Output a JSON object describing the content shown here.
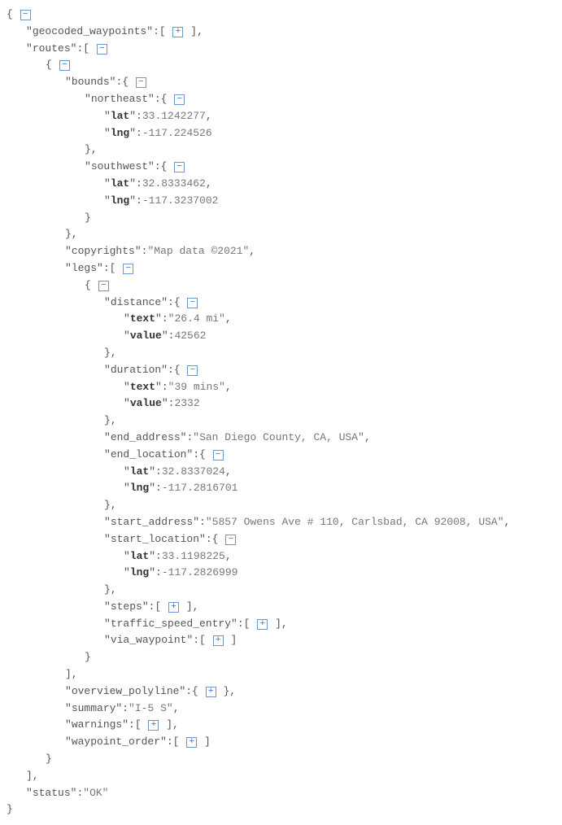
{
  "keys": {
    "geocoded_waypoints": "geocoded_waypoints",
    "routes": "routes",
    "bounds": "bounds",
    "northeast": "northeast",
    "lat": "lat",
    "lng": "lng",
    "southwest": "southwest",
    "copyrights": "copyrights",
    "legs": "legs",
    "distance": "distance",
    "text": "text",
    "value": "value",
    "duration": "duration",
    "end_address": "end_address",
    "end_location": "end_location",
    "start_address": "start_address",
    "start_location": "start_location",
    "steps": "steps",
    "traffic_speed_entry": "traffic_speed_entry",
    "via_waypoint": "via_waypoint",
    "overview_polyline": "overview_polyline",
    "summary": "summary",
    "warnings": "warnings",
    "waypoint_order": "waypoint_order",
    "status": "status"
  },
  "values": {
    "ne_lat": "33.1242277",
    "ne_lng": "-117.224526",
    "sw_lat": "32.8333462",
    "sw_lng": "-117.3237002",
    "copyrights": "Map data ©2021",
    "distance_text": "26.4 mi",
    "distance_value": "42562",
    "duration_text": "39 mins",
    "duration_value": "2332",
    "end_address": "San Diego County, CA, USA",
    "end_lat": "32.8337024",
    "end_lng": "-117.2816701",
    "start_address": "5857 Owens Ave # 110, Carlsbad, CA 92008, USA",
    "start_lat": "33.1198225",
    "start_lng": "-117.2826999",
    "summary": "I-5 S",
    "status": "OK"
  }
}
